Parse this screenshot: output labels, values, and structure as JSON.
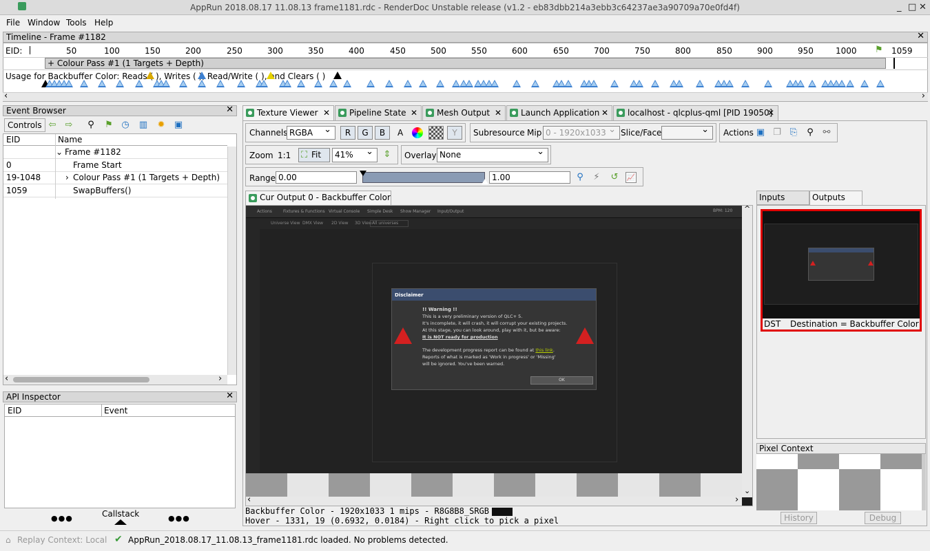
{
  "window": {
    "title": "AppRun  2018.08.17  11.08.13  frame1181.rdc - RenderDoc Unstable release (v1.2 - eb83dbb214a3ebb3c64237ae3a90709a70e0fd4f)"
  },
  "menu": [
    "File",
    "Window",
    "Tools",
    "Help"
  ],
  "timeline": {
    "title": "Timeline - Frame #1182",
    "eid_label": "EID:",
    "ticks": [
      "50",
      "100",
      "150",
      "200",
      "250",
      "300",
      "350",
      "400",
      "450",
      "500",
      "550",
      "600",
      "650",
      "700",
      "750",
      "800",
      "850",
      "900",
      "950",
      "1000"
    ],
    "end_eid": "1059",
    "pass_label": "+ Colour Pass #1 (1 Targets + Depth)",
    "usage_text": "Usage for Backbuffer Color: Reads (  ), Writes (  ), Read/Write (  ), and Clears (  )"
  },
  "event_browser": {
    "title": "Event Browser",
    "controls_label": "Controls",
    "col_eid": "EID",
    "col_name": "Name",
    "rows": [
      {
        "eid": "",
        "name": "Frame #1182"
      },
      {
        "eid": "0",
        "name": "Frame Start"
      },
      {
        "eid": "19-1048",
        "name": "Colour Pass #1 (1 Targets + Depth)"
      },
      {
        "eid": "1059",
        "name": "SwapBuffers()"
      }
    ]
  },
  "api_inspector": {
    "title": "API Inspector",
    "col_eid": "EID",
    "col_event": "Event",
    "callstack": "Callstack",
    "dots": "●●●"
  },
  "tabs": [
    "Texture Viewer",
    "Pipeline State",
    "Mesh Output",
    "Launch Application",
    "localhost - qlcplus-qml [PID 19050]"
  ],
  "toolbar": {
    "channels_label": "Channels",
    "channels_value": "RGBA",
    "r": "R",
    "g": "G",
    "b": "B",
    "a": "A",
    "y": "Y",
    "subresource": "Subresource",
    "mip_label": "Mip",
    "mip_value": "0 - 1920x1033",
    "slice_label": "Slice/Face",
    "actions_label": "Actions",
    "zoom_label": "Zoom",
    "one_to_one": "1:1",
    "fit": "Fit",
    "zoom_value": "41%",
    "overlay_label": "Overlay",
    "overlay_value": "None",
    "range_label": "Range",
    "range_min": "0.00",
    "range_max": "1.00"
  },
  "viewer": {
    "tab": "Cur Output 0 - Backbuffer Color",
    "status1": "Backbuffer Color - 1920x1033 1 mips - R8G8B8_SRGB",
    "status2": "Hover - 1331,   19 (0.6932, 0.0184) - Right click to pick a pixel"
  },
  "inner_app": {
    "menu": [
      "Actions",
      "Fixtures & Functions",
      "Virtual Console",
      "Simple Desk",
      "Show Manager",
      "Input/Output"
    ],
    "views": [
      "Universe View",
      "DMX View",
      "2D View",
      "3D View"
    ],
    "universes": "All universes",
    "bpm": "BPM: 120",
    "dialog_title": "Disclaimer",
    "warning": "!! Warning !!",
    "lines": [
      "This is a very preliminary version of QLC+ 5.",
      "It's incomplete, it will crash, it will corrupt your existing projects.",
      "At this stage, you can look around, play with it, but be aware:"
    ],
    "bold_line": "It is NOT ready for production",
    "lines2_pre": "The development progress report can be found at ",
    "link": "this link",
    "lines2_post": ".",
    "lines3": [
      "Reports of what is marked as 'Work in progress' or 'Missing'",
      "will be ignored. You've been warned."
    ],
    "ok": "OK"
  },
  "side": {
    "tab_inputs": "Inputs",
    "tab_outputs": "Outputs",
    "dst": "DST",
    "dest": "Destination = Backbuffer Color",
    "pixel_context": "Pixel Context",
    "history": "History",
    "debug": "Debug"
  },
  "statusbar": {
    "replay": "Replay Context: Local",
    "message": "AppRun_2018.08.17_11.08.13_frame1181.rdc loaded. No problems detected."
  }
}
